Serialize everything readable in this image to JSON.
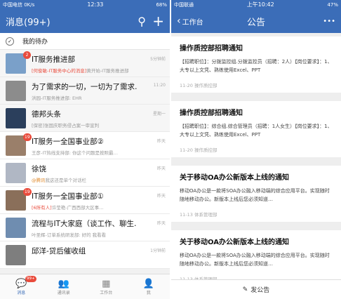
{
  "left": {
    "status": {
      "carrier": "中国电信 0K/s",
      "time": "12:33",
      "battery": "68%"
    },
    "header": {
      "title": "消息(99+)"
    },
    "todo": {
      "label": "我的待办"
    },
    "items": [
      {
        "title": "IT服务推进部",
        "tag": "[何俊敏-IT服务中心的消息]",
        "sub": "黄开始-IT服务推进部",
        "time": "5分钟前",
        "badge": "2",
        "avatar_color": "#7aa0c9"
      },
      {
        "title": "为了需求的一切，一切为了需求…",
        "tag": "",
        "sub": "洪园-IT服务推进部: EHR",
        "time": "11:20",
        "badge": "",
        "avatar_color": "#8c8c8c"
      },
      {
        "title": "德邦头条",
        "tag": "",
        "sub": "[保密]张国庆职务侵占案一审宣判",
        "time": "星期一",
        "badge": "",
        "avatar_color": "#2b3f5c"
      },
      {
        "title": "IT服务一全国事业部②",
        "tag": "",
        "sub": "王彦-IT热线支持部: 你这个问题是按照最…",
        "time": "昨天",
        "badge": "19",
        "avatar_color": "#9a7f6a"
      },
      {
        "title": "徐饶",
        "tag2": "@腾讯",
        "tag": "",
        "sub": "我这还是单个对话栏",
        "time": "昨天",
        "badge": "",
        "avatar_color": "#b0b7c4"
      },
      {
        "title": "IT服务一全国事业部①",
        "tag": "[6所有人]",
        "sub": "许莹艳-广西西部大区事…",
        "time": "昨天",
        "badge": "19",
        "avatar_color": "#8a6f5a"
      },
      {
        "title": "流程与IT大家庭（谈工作、聊生…",
        "tag": "",
        "sub": "叶圣辉-订单系统研发部: 好的 我看看",
        "time": "昨天",
        "badge": "",
        "avatar_color": "#6f8db0"
      },
      {
        "title": "邱洋-贷后催收组",
        "tag": "",
        "sub": "",
        "time": "1分钟前",
        "badge": "",
        "avatar_color": "#7e7e7e"
      }
    ],
    "tabs": [
      {
        "label": "消息",
        "icon": "💬",
        "badge": "99+"
      },
      {
        "label": "通讯录",
        "icon": "👥",
        "badge": ""
      },
      {
        "label": "工作台",
        "icon": "▦",
        "badge": ""
      },
      {
        "label": "我",
        "icon": "👤",
        "badge": ""
      }
    ]
  },
  "right": {
    "status": {
      "carrier": "中国联通",
      "time": "上午10:42",
      "battery": "47%"
    },
    "header": {
      "back": "工作台",
      "title": "公告",
      "more": "•••"
    },
    "cards": [
      {
        "title": "操作质控部招聘通知",
        "body": "【招聘职位】：分拨监控组.分拨监控员（招聘：2人）【岗位要求】：1、大专以上文凭、熟练使用Excel、PPT",
        "meta": "11-20  操作质控部"
      },
      {
        "title": "操作质控部招聘通知",
        "body": "【招聘职位】：综合组.综合管理员（招聘：1人女生）【岗位要求】：1、大专以上文凭、熟练使用Excel、PPT",
        "meta": "11-20  操作质控部"
      },
      {
        "title": "关于移动OA办公新版本上线的通知",
        "body": "移动OA办公是一款将SOA办公融入移动端的综合应用平台。实现随时随地移动办公。新版本上线后您必须知道…",
        "meta": "11-13  体系管理部"
      },
      {
        "title": "关于移动OA办公新版本上线的通知",
        "body": "移动OA办公是一款将SOA办公融入移动端的综合应用平台。实现随时随地移动办公。新版本上线后您必须知道…",
        "meta": "11-13  体系管理部"
      }
    ],
    "post_label": "发公告"
  }
}
